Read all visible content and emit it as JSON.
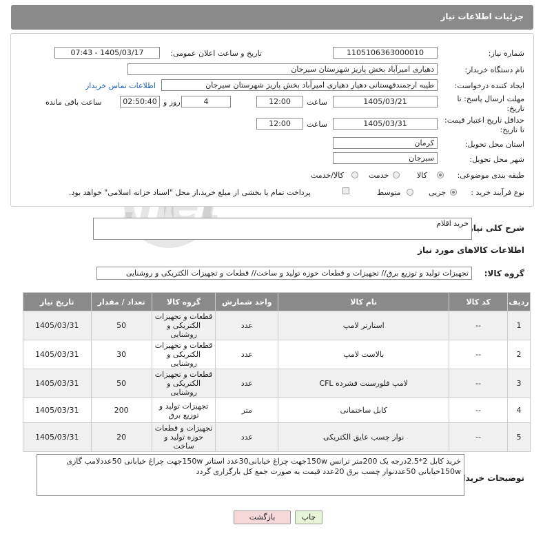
{
  "header": {
    "title": "جزئیات اطلاعات نیاز"
  },
  "form": {
    "need_number_label": "شماره نیاز:",
    "need_number": "1105106363000010",
    "announce_label": "تاریخ و ساعت اعلان عمومی:",
    "announce_value": "1405/03/17 - 07:43",
    "buyer_org_label": "نام دستگاه خریدار:",
    "buyer_org": "دهیاری امیرآباد بخش پاریز شهرستان سیرجان",
    "creator_label": "ایجاد کننده درخواست:",
    "creator": "طیبه ارجمندقهستانی دهیار دهیاری امیرآباد بخش پاریز شهرستان سیرجان",
    "contact_link": "اطلاعات تماس خریدار",
    "deadline_label_1": "مهلت ارسال پاسخ: تا",
    "deadline_label_2": "تاریخ:",
    "deadline_date": "1405/03/21",
    "time_label": "ساعت",
    "deadline_time": "12:00",
    "days_value": "4",
    "days_label": "روز و",
    "remaining_time": "02:50:40",
    "remaining_label": "ساعت باقی مانده",
    "min_valid_label_1": "حداقل تاریخ اعتبار قیمت:",
    "min_valid_label_2": "تا تاریخ:",
    "valid_date": "1405/03/31",
    "valid_time": "12:00",
    "province_label": "استان محل تحویل:",
    "province": "کرمان",
    "city_label": "شهر محل تحویل:",
    "city": "سیرجان",
    "category_label": "طبقه بندی موضوعی:",
    "cat_goods": "کالا",
    "cat_service": "خدمت",
    "cat_goods_service": "کالا/خدمت",
    "process_label": "نوع فرآیند خرید :",
    "proc_minor": "جزیی",
    "proc_medium": "متوسط",
    "payment_note": "پرداخت تمام یا بخشی از مبلغ خرید،از محل \"اسناد خزانه اسلامی\" خواهد بود."
  },
  "summary": {
    "label": "شرح کلی نیاز:",
    "value": "خرید اقلام"
  },
  "goods_info_title": "اطلاعات کالاهای مورد نیاز",
  "goods_group": {
    "label": "گروه کالا:",
    "value": "تجهیزات تولید و توزیع برق// تجهیزات و قطعات حوزه تولید و ساخت// قطعات و تجهیزات الکتریکی و روشنایی"
  },
  "table": {
    "headers": [
      "ردیف",
      "کد کالا",
      "نام کالا",
      "واحد شمارش",
      "گروه کالا",
      "تعداد / مقدار",
      "تاریخ نیاز"
    ],
    "rows": [
      {
        "idx": "1",
        "code": "--",
        "name": "استارتر لامپ",
        "unit": "عدد",
        "group": "قطعات و تجهیزات الکتریکی و روشنایی",
        "qty": "50",
        "date": "1405/03/31"
      },
      {
        "idx": "2",
        "code": "--",
        "name": "بالاست لامپ",
        "unit": "عدد",
        "group": "قطعات و تجهیزات الکتریکی و روشنایی",
        "qty": "30",
        "date": "1405/03/31"
      },
      {
        "idx": "3",
        "code": "--",
        "name": "لامپ فلورسنت فشرده CFL",
        "unit": "عدد",
        "group": "قطعات و تجهیزات الکتریکی و روشنایی",
        "qty": "50",
        "date": "1405/03/31"
      },
      {
        "idx": "4",
        "code": "--",
        "name": "کابل ساختمانی",
        "unit": "متر",
        "group": "تجهیزات تولید و توزیع برق",
        "qty": "200",
        "date": "1405/03/31"
      },
      {
        "idx": "5",
        "code": "--",
        "name": "نوار چسب عایق الکتریکی",
        "unit": "عدد",
        "group": "تجهیزات و قطعات حوزه تولید و ساخت",
        "qty": "20",
        "date": "1405/03/31"
      }
    ]
  },
  "buyer_notes": {
    "label": "توضیحات خریدار:",
    "value": "خرید کابل 2*2.5درجه یک 200متر ترانس 150wجهت چراغ خیابانی30عدد استاتر 150wجهت چراغ خیابانی 50عددلامپ گازی 150wخیابانی  50عددنوار چسب برق 20عدد قیمت به صورت جمع کل بارگزاری گردد"
  },
  "buttons": {
    "print": "چاپ",
    "back": "بازگشت"
  },
  "watermark_text": "AriaTender.net",
  "colors": {
    "header_bg": "#8a8a8a",
    "back_btn_bg": "#f6d8d8",
    "print_btn_bg": "#e6f5d8",
    "link": "#1a5fb4"
  }
}
